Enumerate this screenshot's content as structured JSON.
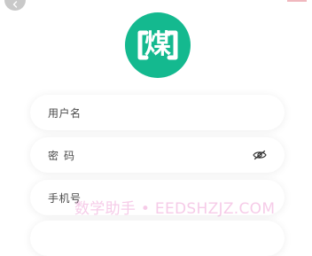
{
  "form": {
    "username_placeholder": "用户名",
    "password_placeholder": "密码",
    "phone_placeholder": "手机号"
  },
  "logo": {
    "char": "煤",
    "color": "#14b98f"
  },
  "watermark": {
    "text": "数学助手 • EEDSHZJZ.COM"
  },
  "icons": {
    "back": "chevron-left-icon",
    "password_toggle": "eye-off-icon"
  }
}
